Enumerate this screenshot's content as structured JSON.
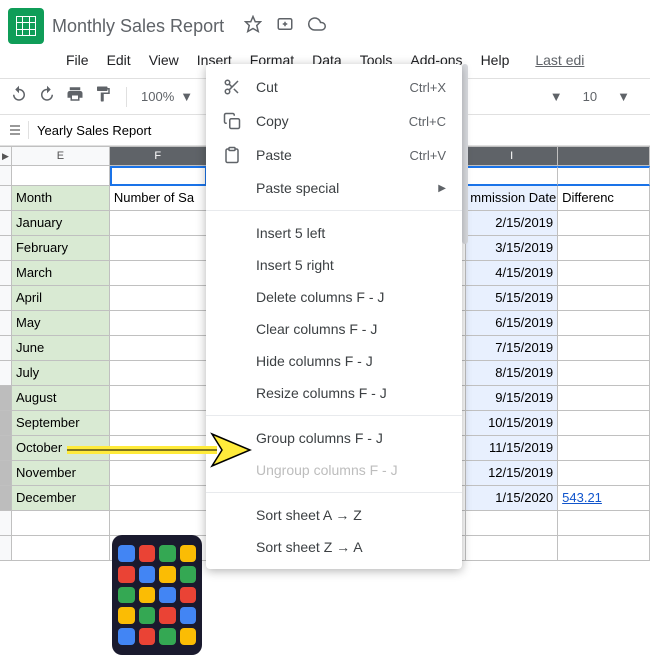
{
  "doc_title": "Monthly Sales Report",
  "menubar": [
    "File",
    "Edit",
    "View",
    "Insert",
    "Format",
    "Data",
    "Tools",
    "Add-ons",
    "Help"
  ],
  "last_edit": "Last edi",
  "zoom": "100%",
  "font_size": "10",
  "tab_name": "Yearly Sales Report",
  "columns": {
    "E": "E",
    "F": "F",
    "I": "I"
  },
  "headers": {
    "month": "Month",
    "sales": "Number of Sa",
    "commission": "mmission Date",
    "diff": "Differenc"
  },
  "rows": [
    {
      "month": "January",
      "date": "2/15/2019"
    },
    {
      "month": "February",
      "date": "3/15/2019"
    },
    {
      "month": "March",
      "date": "4/15/2019"
    },
    {
      "month": "April",
      "date": "5/15/2019"
    },
    {
      "month": "May",
      "date": "6/15/2019"
    },
    {
      "month": "June",
      "date": "7/15/2019"
    },
    {
      "month": "July",
      "date": "8/15/2019"
    },
    {
      "month": "August",
      "date": "9/15/2019"
    },
    {
      "month": "September",
      "date": "10/15/2019"
    },
    {
      "month": "October",
      "date": "11/15/2019"
    },
    {
      "month": "November",
      "date": "12/15/2019"
    },
    {
      "month": "December",
      "date": "1/15/2020"
    }
  ],
  "link_value": "543.21",
  "context_menu": {
    "cut": "Cut",
    "cut_key": "Ctrl+X",
    "copy": "Copy",
    "copy_key": "Ctrl+C",
    "paste": "Paste",
    "paste_key": "Ctrl+V",
    "paste_special": "Paste special",
    "insert_left": "Insert 5 left",
    "insert_right": "Insert 5 right",
    "delete_cols": "Delete columns F - J",
    "clear_cols": "Clear columns F - J",
    "hide_cols": "Hide columns F - J",
    "resize_cols": "Resize columns F - J",
    "group_cols": "Group columns F - J",
    "ungroup_cols": "Ungroup columns F - J",
    "sort_az": "Sort sheet A → Z",
    "sort_za": "Sort sheet Z → A"
  }
}
